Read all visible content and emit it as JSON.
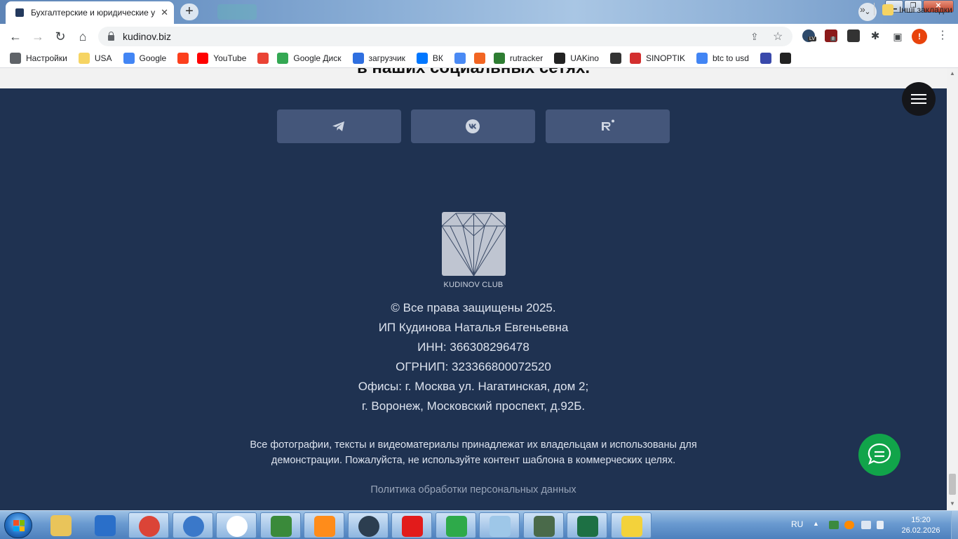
{
  "browser": {
    "tab_title": "Бухгалтерские и юридические у",
    "url": "kudinov.biz",
    "profile_letter": "!",
    "ext_badges": [
      "LV",
      "8"
    ]
  },
  "bookmarks": [
    {
      "label": "Настройки",
      "icon": "gear-icon",
      "color": "#5f6368"
    },
    {
      "label": "USA",
      "icon": "folder-icon",
      "color": "#f6d463"
    },
    {
      "label": "Google",
      "icon": "google-icon",
      "color": "#4285f4"
    },
    {
      "label": "",
      "icon": "yandex-icon",
      "color": "#fc3f1d"
    },
    {
      "label": "YouTube",
      "icon": "youtube-icon",
      "color": "#ff0000"
    },
    {
      "label": "",
      "icon": "gmail-icon",
      "color": "#ea4335"
    },
    {
      "label": "Google Диск",
      "icon": "google-drive-icon",
      "color": "#34a853"
    },
    {
      "label": "загрузчик",
      "icon": "loader-icon",
      "color": "#2f6fe0"
    },
    {
      "label": "ВК",
      "icon": "vk-icon",
      "color": "#0077ff"
    },
    {
      "label": "",
      "icon": "translate-icon",
      "color": "#4a8af4"
    },
    {
      "label": "",
      "icon": "f-icon",
      "color": "#f26522"
    },
    {
      "label": "rutracker",
      "icon": "rutracker-icon",
      "color": "#2e7d32"
    },
    {
      "label": "UAKino",
      "icon": "uakino-icon",
      "color": "#222222"
    },
    {
      "label": "",
      "icon": "knight-icon",
      "color": "#333333"
    },
    {
      "label": "SINOPTIK",
      "icon": "thermometer-icon",
      "color": "#d32f2f"
    },
    {
      "label": "btc to usd",
      "icon": "google-icon",
      "color": "#4285f4"
    },
    {
      "label": "",
      "icon": "arrow-icon",
      "color": "#3949ab"
    },
    {
      "label": "",
      "icon": "bc-icon",
      "color": "#222222"
    }
  ],
  "bookmarks_more": "»",
  "bookmarks_other": "Інші закладки",
  "page": {
    "social_heading": "в наших социальных сетях.",
    "social_buttons": [
      "telegram",
      "vk",
      "rutube"
    ],
    "logo_text": "KUDINOV CLUB",
    "info_lines": [
      "© Все права защищены 2025.",
      "ИП Кудинова Наталья Евгеньевна",
      "ИНН: 366308296478",
      "ОГРНИП: 323366800072520",
      "Офисы: г. Москва ул. Нагатинская, дом 2;",
      "г. Воронеж, Московский проспект, д.92Б."
    ],
    "notice_line1": "Все фотографии, тексты и видеоматериалы принадлежат их владельцам и использованы для",
    "notice_line2": "демонстрации. Пожалуйста, не используйте контент шаблона в коммерческих целях.",
    "policy_link": "Политика обработки персональных данных"
  },
  "taskbar": {
    "lang": "RU",
    "time": "15:20",
    "date": "26.02.2026",
    "apps": [
      "explorer",
      "wise-care",
      "chrome",
      "network",
      "yandex-browser",
      "excel-green",
      "media-player",
      "clock",
      "total-commander-64",
      "color-app",
      "notes",
      "monitor",
      "excel",
      "calendar"
    ]
  },
  "colors": {
    "footer_bg": "#1f3251",
    "social_btn": "#44567a",
    "chat_btn": "#11a44a"
  }
}
